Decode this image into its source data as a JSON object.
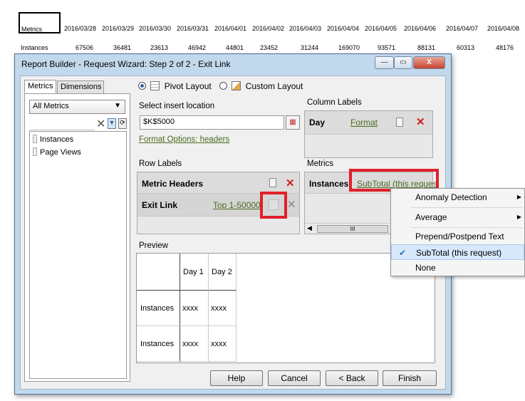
{
  "sheet": {
    "row1_label": "Metrics",
    "row2_label": "Instances",
    "dates": [
      "2016/03/28",
      "2016/03/29",
      "2016/03/30",
      "2016/03/31",
      "2016/04/01",
      "2016/04/02",
      "2016/04/03",
      "2016/04/04",
      "2016/04/05",
      "2016/04/06",
      "2016/04/07",
      "2016/04/08"
    ],
    "values": [
      "67506",
      "36481",
      "23613",
      "46942",
      "44801",
      "23452",
      "31244",
      "169070",
      "93571",
      "88131",
      "60313",
      "48176"
    ]
  },
  "dialog": {
    "title": "Report Builder - Request Wizard: Step 2 of 2 - Exit Link",
    "minimize": "—",
    "restore": "▭",
    "close": "X"
  },
  "left": {
    "tabs": [
      "Metrics",
      "Dimensions"
    ],
    "dropdown_value": "All Metrics",
    "search_value": "",
    "items": [
      "Instances",
      "Page Views"
    ]
  },
  "layout": {
    "pivot_label": "Pivot Layout",
    "custom_label": "Custom Layout"
  },
  "insert": {
    "label": "Select insert location",
    "value": "$K$5000",
    "format_options": "Format Options: headers"
  },
  "column_labels": {
    "title": "Column Labels",
    "item": "Day",
    "format": "Format"
  },
  "row_labels": {
    "title": "Row Labels",
    "header": "Metric Headers",
    "item": "Exit Link",
    "top": "Top 1-50000"
  },
  "metrics": {
    "title": "Metrics",
    "item": "Instances",
    "subtotal": "SubTotal (this reques",
    "scroll_thumb": "III"
  },
  "preview": {
    "title": "Preview",
    "col1": "Day 1",
    "col2": "Day 2",
    "row_label": "Instances",
    "placeholder": "xxxx"
  },
  "buttons": {
    "help": "Help",
    "cancel": "Cancel",
    "back": "< Back",
    "finish": "Finish"
  },
  "context_menu": {
    "items": [
      "Anomaly Detection",
      "Average",
      "Prepend/Postpend Text",
      "SubTotal (this request)",
      "None"
    ],
    "checked": "SubTotal (this request)"
  }
}
